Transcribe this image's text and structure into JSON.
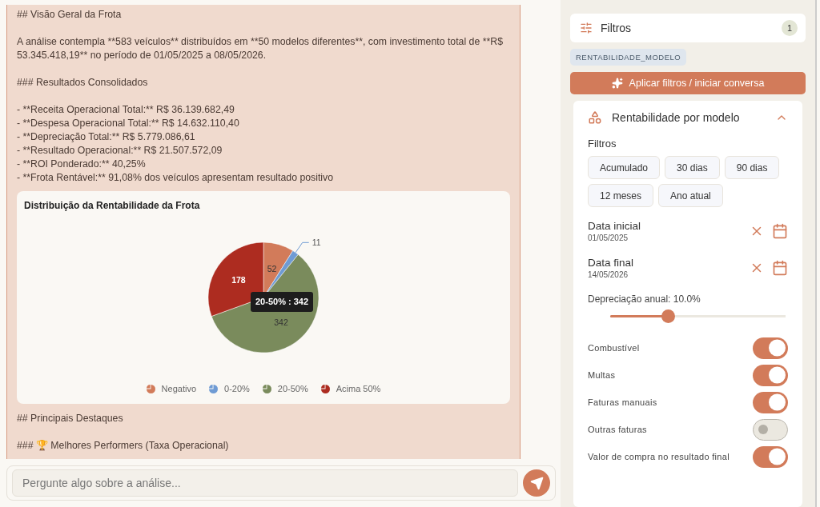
{
  "message": {
    "lines": [
      {
        "kind": "heading",
        "text": "## Visão Geral da Frota"
      },
      {
        "kind": "paragraph",
        "text": "A análise contempla **583 veículos** distribuídos em **50 modelos diferentes**, com investimento total de **R$ 53.345.418,19** no período de 01/05/2025 a 08/05/2026."
      },
      {
        "kind": "heading",
        "text": "### Resultados Consolidados"
      },
      {
        "kind": "list",
        "items": [
          "- **Receita Operacional Total:** R$ 36.139.682,49",
          "- **Despesa Operacional Total:** R$ 14.632.110,40",
          "- **Depreciação Total:** R$ 5.779.086,61",
          "- **Resultado Operacional:** R$ 21.507.572,09",
          "- **ROI Ponderado:** 40,25%",
          "- **Frota Rentável:** 91,08% dos veículos apresentam resultado positivo"
        ]
      },
      {
        "kind": "chart"
      },
      {
        "kind": "heading",
        "text": "## Principais Destaques"
      },
      {
        "kind": "heading",
        "text": "### 🏆 Melhores Performers (Taxa Operacional)"
      }
    ],
    "chart": {
      "chart_data": {
        "type": "pie",
        "title": "Distribuição da Rentabilidade da Frota",
        "categories": [
          "Negativo",
          "0-20%",
          "20-50%",
          "Acima 50%"
        ],
        "values": [
          52,
          11,
          342,
          178
        ],
        "data_labels": true
      },
      "legend": [
        {
          "color": "#d27b5a"
        },
        {
          "color": "#6f9bd4"
        },
        {
          "color": "#7a8b5c"
        },
        {
          "color": "#ad2c20"
        }
      ],
      "tooltip": "20-50% : 342"
    }
  },
  "chat_input": {
    "placeholder": "Pergunte algo sobre a análise..."
  },
  "sidebar": {
    "filters_header": {
      "label": "Filtros",
      "count": "1"
    },
    "tag": "RENTABILIDADE_MODELO",
    "apply_button": "Aplicar filtros / iniciar conversa",
    "section": {
      "title": "Rentabilidade por modelo",
      "expanded": true,
      "filters_label": "Filtros",
      "periods": [
        {
          "label": "Acumulado",
          "selected": false
        },
        {
          "label": "30 dias",
          "selected": false
        },
        {
          "label": "90 dias",
          "selected": false
        },
        {
          "label": "12 meses",
          "selected": false
        },
        {
          "label": "Ano atual",
          "selected": false
        }
      ],
      "dates": [
        {
          "label": "Data inicial",
          "value": "01/05/2025"
        },
        {
          "label": "Data final",
          "value": "14/05/2026"
        }
      ],
      "depreciation": {
        "label": "Depreciação anual: 10.0%",
        "level": 0.33
      },
      "toggles": [
        {
          "label": "Combustível",
          "on": true
        },
        {
          "label": "Multas",
          "on": true
        },
        {
          "label": "Faturas manuais",
          "on": true
        },
        {
          "label": "Outras faturas",
          "on": false
        },
        {
          "label": "Valor de compra no resultado final",
          "on": true
        }
      ]
    }
  }
}
